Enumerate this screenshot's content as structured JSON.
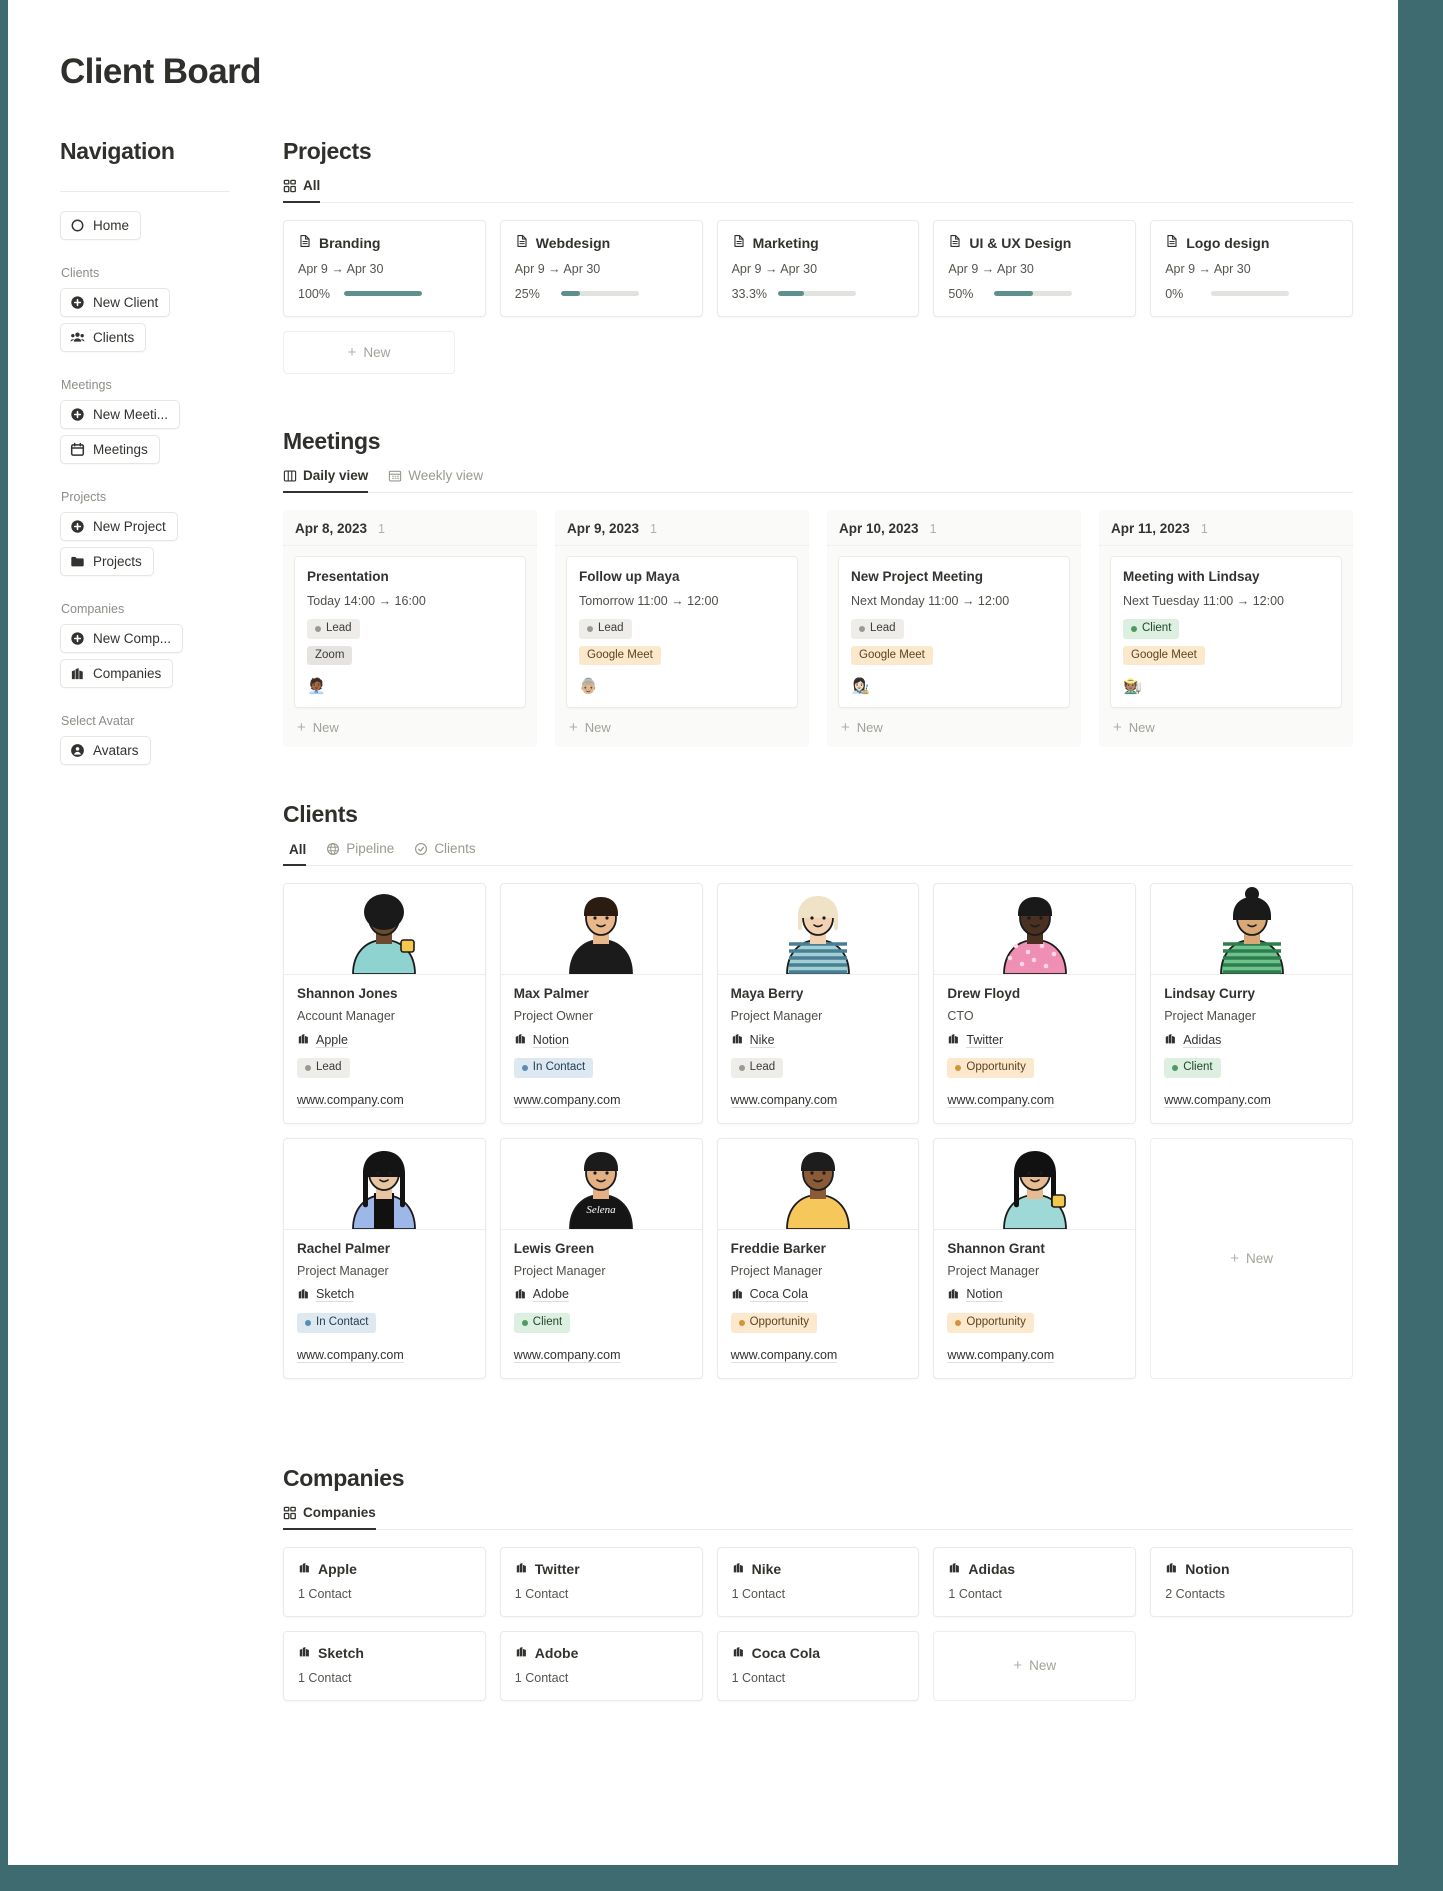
{
  "page": {
    "title": "Client Board"
  },
  "sidebar": {
    "heading": "Navigation",
    "home": {
      "label": "Home",
      "icon": "circle-icon"
    },
    "groups": [
      {
        "label": "Clients",
        "items": [
          {
            "label": "New Client",
            "icon": "plus-circle-icon"
          },
          {
            "label": "Clients",
            "icon": "people-icon"
          }
        ]
      },
      {
        "label": "Meetings",
        "items": [
          {
            "label": "New Meeti...",
            "icon": "plus-circle-icon"
          },
          {
            "label": "Meetings",
            "icon": "calendar-icon"
          }
        ]
      },
      {
        "label": "Projects",
        "items": [
          {
            "label": "New Project",
            "icon": "plus-circle-icon"
          },
          {
            "label": "Projects",
            "icon": "folder-icon"
          }
        ]
      },
      {
        "label": "Companies",
        "items": [
          {
            "label": "New Comp...",
            "icon": "plus-circle-icon"
          },
          {
            "label": "Companies",
            "icon": "building-icon"
          }
        ]
      },
      {
        "label": "Select Avatar",
        "items": [
          {
            "label": "Avatars",
            "icon": "user-circle-icon"
          }
        ]
      }
    ]
  },
  "projects": {
    "title": "Projects",
    "tabs": [
      {
        "label": "All",
        "icon": "grid-icon",
        "active": true
      }
    ],
    "new_label": "New",
    "accent": "#5d8f8c",
    "items": [
      {
        "name": "Branding",
        "dates": "Apr 9 → Apr 30",
        "percent_label": "100%",
        "percent": 100
      },
      {
        "name": "Webdesign",
        "dates": "Apr 9 → Apr 30",
        "percent_label": "25%",
        "percent": 25
      },
      {
        "name": "Marketing",
        "dates": "Apr 9 → Apr 30",
        "percent_label": "33.3%",
        "percent": 33.3
      },
      {
        "name": "UI & UX Design",
        "dates": "Apr 9 → Apr 30",
        "percent_label": "50%",
        "percent": 50
      },
      {
        "name": "Logo design",
        "dates": "Apr 9 → Apr 30",
        "percent_label": "0%",
        "percent": 0
      }
    ]
  },
  "meetings": {
    "title": "Meetings",
    "tabs": [
      {
        "label": "Daily view",
        "icon": "columns-icon",
        "active": true
      },
      {
        "label": "Weekly view",
        "icon": "calendar-grid-icon",
        "active": false
      }
    ],
    "new_label": "New",
    "columns": [
      {
        "date": "Apr 8, 2023",
        "count": "1",
        "card": {
          "title": "Presentation",
          "time": "Today 14:00 → 16:00",
          "status": {
            "label": "Lead",
            "bg": "#eeedea",
            "fg": "#3c3b37",
            "dot": "#9b9a92"
          },
          "platform": {
            "label": "Zoom",
            "bg": "#e5e4e0",
            "fg": "#3c3b37"
          },
          "avatar": "🧑🏾‍💼"
        }
      },
      {
        "date": "Apr 9, 2023",
        "count": "1",
        "card": {
          "title": "Follow up Maya",
          "time": "Tomorrow 11:00 → 12:00",
          "status": {
            "label": "Lead",
            "bg": "#eeedea",
            "fg": "#3c3b37",
            "dot": "#9b9a92"
          },
          "platform": {
            "label": "Google Meet",
            "bg": "#fbe8cd",
            "fg": "#5c4420"
          },
          "avatar": "👵🏼"
        }
      },
      {
        "date": "Apr 10, 2023",
        "count": "1",
        "card": {
          "title": "New Project Meeting",
          "time": "Next Monday 11:00 → 12:00",
          "status": {
            "label": "Lead",
            "bg": "#eeedea",
            "fg": "#3c3b37",
            "dot": "#9b9a92"
          },
          "platform": {
            "label": "Google Meet",
            "bg": "#fbe8cd",
            "fg": "#5c4420"
          },
          "avatar": "👩🏻‍🎨"
        }
      },
      {
        "date": "Apr 11, 2023",
        "count": "1",
        "card": {
          "title": "Meeting with Lindsay",
          "time": "Next Tuesday 11:00 → 12:00",
          "status": {
            "label": "Client",
            "bg": "#dcefe0",
            "fg": "#22452b",
            "dot": "#4e9a5f"
          },
          "platform": {
            "label": "Google Meet",
            "bg": "#fbe8cd",
            "fg": "#5c4420"
          },
          "avatar": "🧑🏽‍🌾"
        }
      }
    ]
  },
  "clients": {
    "title": "Clients",
    "tabs": [
      {
        "label": "All",
        "icon": "people-icon",
        "active": true
      },
      {
        "label": "Pipeline",
        "icon": "globe-icon",
        "active": false
      },
      {
        "label": "Clients",
        "icon": "check-badge-icon",
        "active": false
      }
    ],
    "new_label": "New",
    "items": [
      {
        "name": "Shannon Jones",
        "role": "Account Manager",
        "company": "Apple",
        "status": {
          "label": "Lead",
          "bg": "#eeedea",
          "fg": "#3c3b37",
          "dot": "#9b9a92"
        },
        "url": "www.company.com",
        "avatar": "woman-teal-cup"
      },
      {
        "name": "Max Palmer",
        "role": "Project Owner",
        "company": "Notion",
        "status": {
          "label": "In Contact",
          "bg": "#dde8f1",
          "fg": "#1f3c52",
          "dot": "#5b8db3"
        },
        "url": "www.company.com",
        "avatar": "man-black-tee"
      },
      {
        "name": "Maya Berry",
        "role": "Project Manager",
        "company": "Nike",
        "status": {
          "label": "Lead",
          "bg": "#eeedea",
          "fg": "#3c3b37",
          "dot": "#9b9a92"
        },
        "url": "www.company.com",
        "avatar": "woman-stripes"
      },
      {
        "name": "Drew Floyd",
        "role": "CTO",
        "company": "Twitter",
        "status": {
          "label": "Opportunity",
          "bg": "#fbe8cd",
          "fg": "#5c4420",
          "dot": "#d2933a"
        },
        "url": "www.company.com",
        "avatar": "person-pink"
      },
      {
        "name": "Lindsay Curry",
        "role": "Project Manager",
        "company": "Adidas",
        "status": {
          "label": "Client",
          "bg": "#dcefe0",
          "fg": "#22452b",
          "dot": "#4e9a5f"
        },
        "url": "www.company.com",
        "avatar": "woman-green-stripes"
      },
      {
        "name": "Rachel Palmer",
        "role": "Project Manager",
        "company": "Sketch",
        "status": {
          "label": "In Contact",
          "bg": "#dde8f1",
          "fg": "#1f3c52",
          "dot": "#5b8db3"
        },
        "url": "www.company.com",
        "avatar": "woman-blue-coat"
      },
      {
        "name": "Lewis Green",
        "role": "Project Manager",
        "company": "Adobe",
        "status": {
          "label": "Client",
          "bg": "#dcefe0",
          "fg": "#22452b",
          "dot": "#4e9a5f"
        },
        "url": "www.company.com",
        "avatar": "man-selena-tee"
      },
      {
        "name": "Freddie Barker",
        "role": "Project Manager",
        "company": "Coca Cola",
        "status": {
          "label": "Opportunity",
          "bg": "#fbe8cd",
          "fg": "#5c4420",
          "dot": "#d2933a"
        },
        "url": "www.company.com",
        "avatar": "person-yellow-shirt"
      },
      {
        "name": "Shannon Grant",
        "role": "Project Manager",
        "company": "Notion",
        "status": {
          "label": "Opportunity",
          "bg": "#fbe8cd",
          "fg": "#5c4420",
          "dot": "#d2933a"
        },
        "url": "www.company.com",
        "avatar": "woman-teal-cup2"
      }
    ]
  },
  "companies": {
    "title": "Companies",
    "tabs": [
      {
        "label": "Companies",
        "icon": "grid-icon",
        "active": true
      }
    ],
    "new_label": "New",
    "items": [
      {
        "name": "Apple",
        "contacts": "1 Contact"
      },
      {
        "name": "Twitter",
        "contacts": "1 Contact"
      },
      {
        "name": "Nike",
        "contacts": "1 Contact"
      },
      {
        "name": "Adidas",
        "contacts": "1 Contact"
      },
      {
        "name": "Notion",
        "contacts": "2 Contacts"
      },
      {
        "name": "Sketch",
        "contacts": "1 Contact"
      },
      {
        "name": "Adobe",
        "contacts": "1 Contact"
      },
      {
        "name": "Coca Cola",
        "contacts": "1 Contact"
      }
    ]
  }
}
